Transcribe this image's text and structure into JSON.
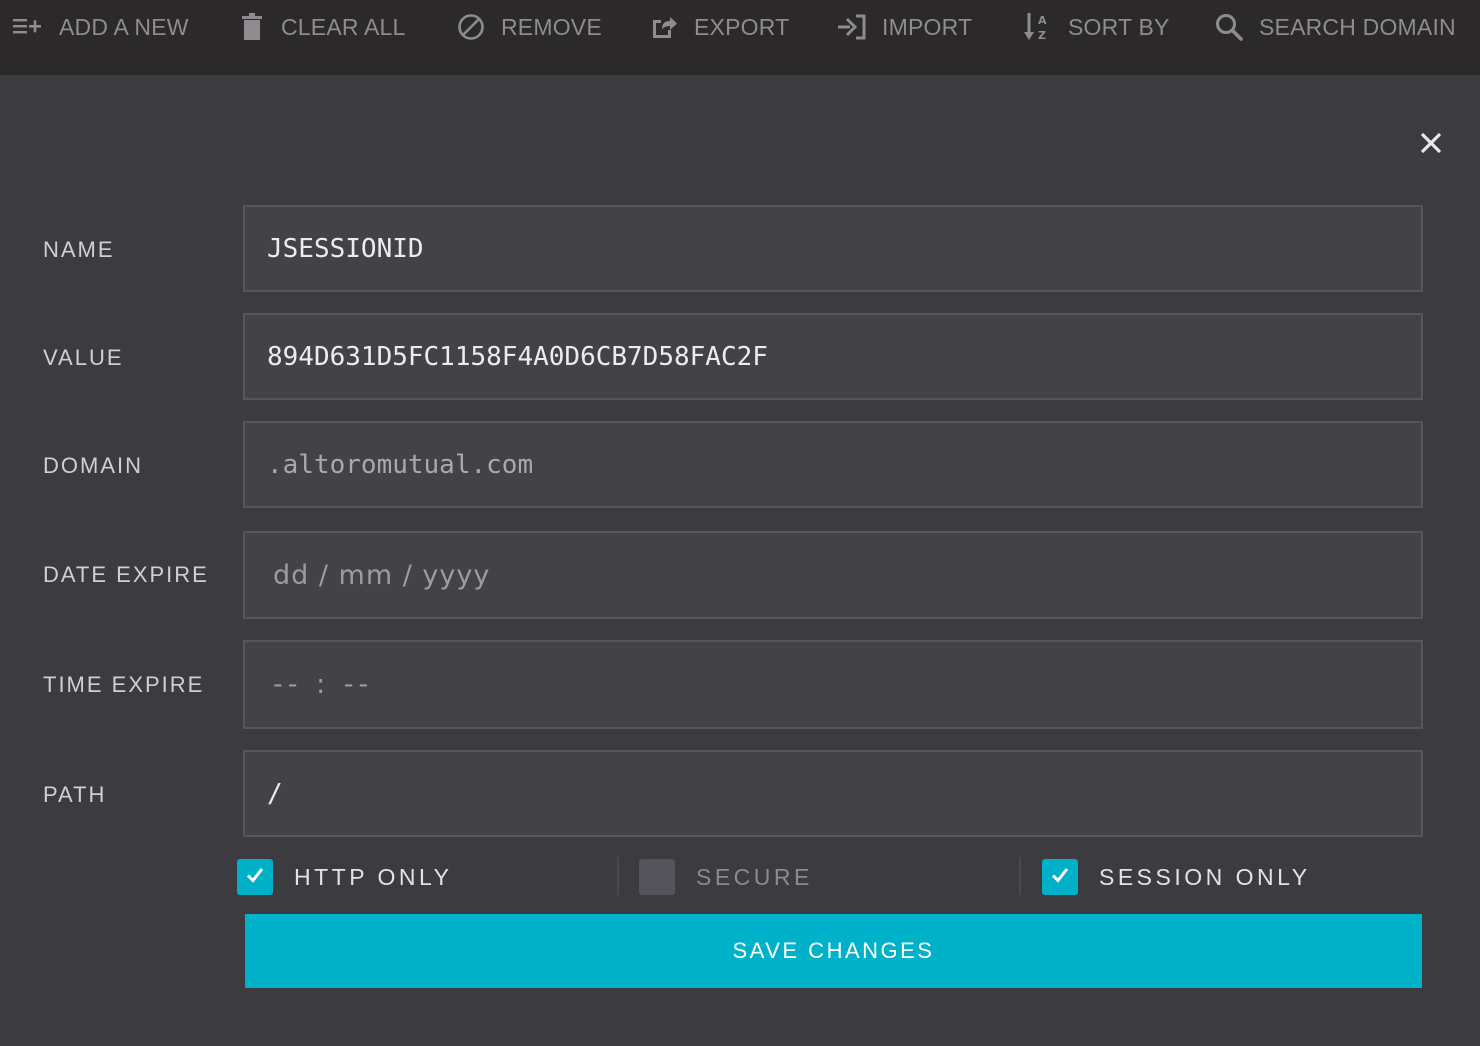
{
  "toolbar": {
    "items": [
      {
        "label": "ADD A NEW",
        "icon": "add-list-icon"
      },
      {
        "label": "CLEAR ALL",
        "icon": "trash-icon"
      },
      {
        "label": "REMOVE",
        "icon": "block-icon"
      },
      {
        "label": "EXPORT",
        "icon": "export-icon"
      },
      {
        "label": "IMPORT",
        "icon": "import-icon"
      },
      {
        "label": "SORT BY",
        "icon": "sort-alpha-icon"
      },
      {
        "label": "SEARCH DOMAIN",
        "icon": "search-icon"
      }
    ]
  },
  "dialog": {
    "close_icon": "close-icon",
    "fields": {
      "name": {
        "label": "NAME",
        "value": "JSESSIONID"
      },
      "value": {
        "label": "VALUE",
        "value": "894D631D5FC1158F4A0D6CB7D58FAC2F"
      },
      "domain": {
        "label": "DOMAIN",
        "value": ".altoromutual.com"
      },
      "date_expire": {
        "label": "DATE EXPIRE",
        "placeholder": "dd / mm / yyyy"
      },
      "time_expire": {
        "label": "TIME EXPIRE",
        "placeholder": "-- : --"
      },
      "path": {
        "label": "PATH",
        "value": "/"
      }
    },
    "options": {
      "http_only": {
        "label": "HTTP ONLY",
        "checked": true
      },
      "secure": {
        "label": "SECURE",
        "checked": false
      },
      "session_only": {
        "label": "SESSION ONLY",
        "checked": true
      }
    },
    "save_label": "SAVE CHANGES"
  },
  "colors": {
    "accent": "#00b2c9",
    "background": "#3c3b40",
    "toolbar": "#2b292a",
    "field": "#434247"
  }
}
